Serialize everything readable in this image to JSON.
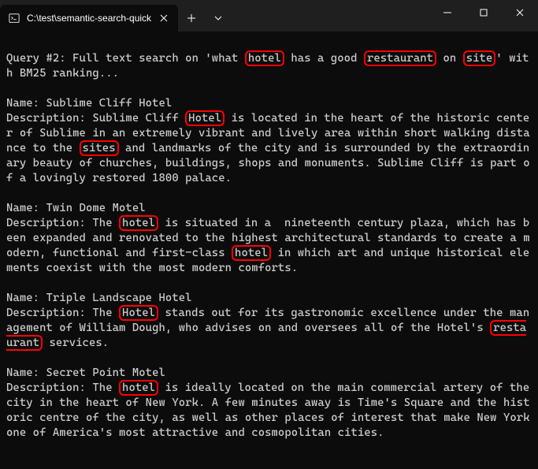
{
  "titlebar": {
    "tab_icon": "terminal-icon",
    "tab_title": "C:\\test\\semantic-search-quick",
    "close_label": "×",
    "new_tab_label": "+",
    "dropdown_label": "⌄"
  },
  "query": {
    "prefix": "Query #2: Full text search on 'what",
    "hl1": "hotel",
    "mid1": " has a good ",
    "hl2": "restaurant",
    "mid2": " on ",
    "hl3": "site",
    "suffix": "' with BM25 ranking..."
  },
  "r1": {
    "name_line": "Name: Sublime Cliff Hotel",
    "d1": "Description: Sublime Cliff ",
    "hl1": "Hotel",
    "d2": " is located in the heart of the historic center of Sublime in an extremely vibrant and lively area within short walking distance to the ",
    "hl2": "sites",
    "d3": " and landmarks of the city and is surrounded by the extraordinary beauty of churches, buildings, shops and monuments. Sublime Cliff is part of a lovingly restored 1800 palace."
  },
  "r2": {
    "name_line": "Name: Twin Dome Motel",
    "d1": "Description: The ",
    "hl1": "hotel",
    "d2": " is situated in a  nineteenth century plaza, which has been expanded and renovated to the highest architectural standards to create a modern, functional and first-class ",
    "hl2": "hotel",
    "d3": " in which art and unique historical elements coexist with the most modern comforts."
  },
  "r3": {
    "name_line": "Name: Triple Landscape Hotel",
    "d1": "Description: The ",
    "hl1": "Hotel",
    "d2": " stands out for its gastronomic excellence under the management of William Dough, who advises on and oversees all of the Hotel's ",
    "hl2": "restaurant",
    "d3": " services."
  },
  "r4": {
    "name_line": "Name: Secret Point Motel",
    "d1": "Description: The ",
    "hl1": "hotel",
    "d2": " is ideally located on the main commercial artery of the city in the heart of New York. A few minutes away is Time's Square and the historic centre of the city, as well as other places of interest that make New York one of America's most attractive and cosmopolitan cities."
  }
}
